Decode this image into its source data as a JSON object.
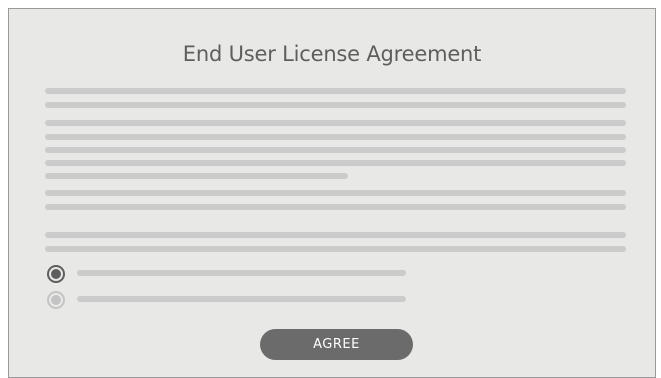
{
  "dialog": {
    "title": "End User License Agreement",
    "agree_label": "AGREE"
  },
  "colors": {
    "background": "#e8e9e6",
    "text": "#5e5e5e",
    "placeholder_line": "#cbcbcb",
    "button": "#6b6b6b",
    "button_text": "#ffffff"
  },
  "options": {
    "selected_index": 0,
    "count": 2
  }
}
